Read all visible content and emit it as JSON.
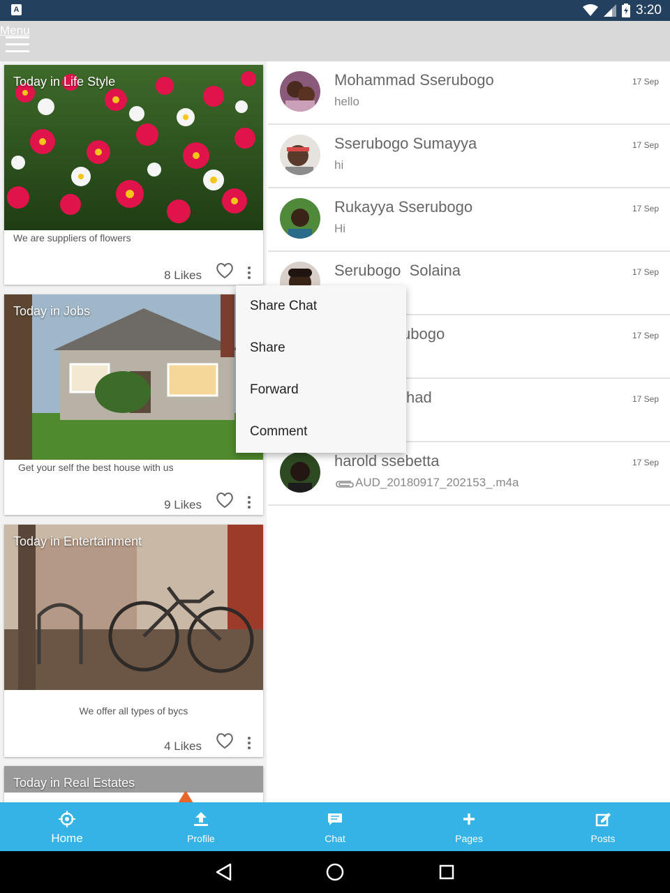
{
  "status_bar": {
    "time": "3:20",
    "app_icon_letter": "A"
  },
  "action_bar": {
    "menu_label": "Menu"
  },
  "feed": {
    "cards": [
      {
        "category": "Today in Life Style",
        "caption": "We are suppliers of flowers",
        "likes": "8 Likes"
      },
      {
        "category": "Today in Jobs",
        "caption": "Get your self the best house with us",
        "likes": "9 Likes"
      },
      {
        "category": "Today in Entertainment",
        "caption": "We offer all types of bycs",
        "likes": "4 Likes"
      },
      {
        "category": "Today in Real Estates"
      }
    ]
  },
  "chats": [
    {
      "name": "Mohammad Sserubogo",
      "message": "hello",
      "date": "17 Sep"
    },
    {
      "name": "Sserubogo Sumayya",
      "message": "hi",
      "date": "17 Sep"
    },
    {
      "name": "Rukayya Sserubogo",
      "message": "Hi",
      "date": "17 Sep"
    },
    {
      "name": "Serubogo  Solaina",
      "message": "",
      "date": "17 Sep"
    },
    {
      "name": "ubogo",
      "message": "",
      "date": "17 Sep"
    },
    {
      "name": "had",
      "message": "",
      "date": "17 Sep"
    },
    {
      "name": "harold ssebetta",
      "message": "AUD_20180917_202153_.m4a",
      "date": "17 Sep"
    }
  ],
  "popup_menu": {
    "items": [
      "Share Chat",
      "Share",
      "Forward",
      "Comment"
    ]
  },
  "bottom_nav": {
    "items": [
      {
        "label": "Home",
        "icon": "home-target-icon",
        "active": true
      },
      {
        "label": "Profile",
        "icon": "upload-icon"
      },
      {
        "label": "Chat",
        "icon": "chat-bubble-icon"
      },
      {
        "label": "Pages",
        "icon": "plus-icon"
      },
      {
        "label": "Posts",
        "icon": "edit-post-icon"
      }
    ]
  },
  "colors": {
    "status_bar": "#24405f",
    "action_bar": "#d9d9d9",
    "bottom_nav": "#35b3e6",
    "accent_orange": "#e8662b"
  }
}
